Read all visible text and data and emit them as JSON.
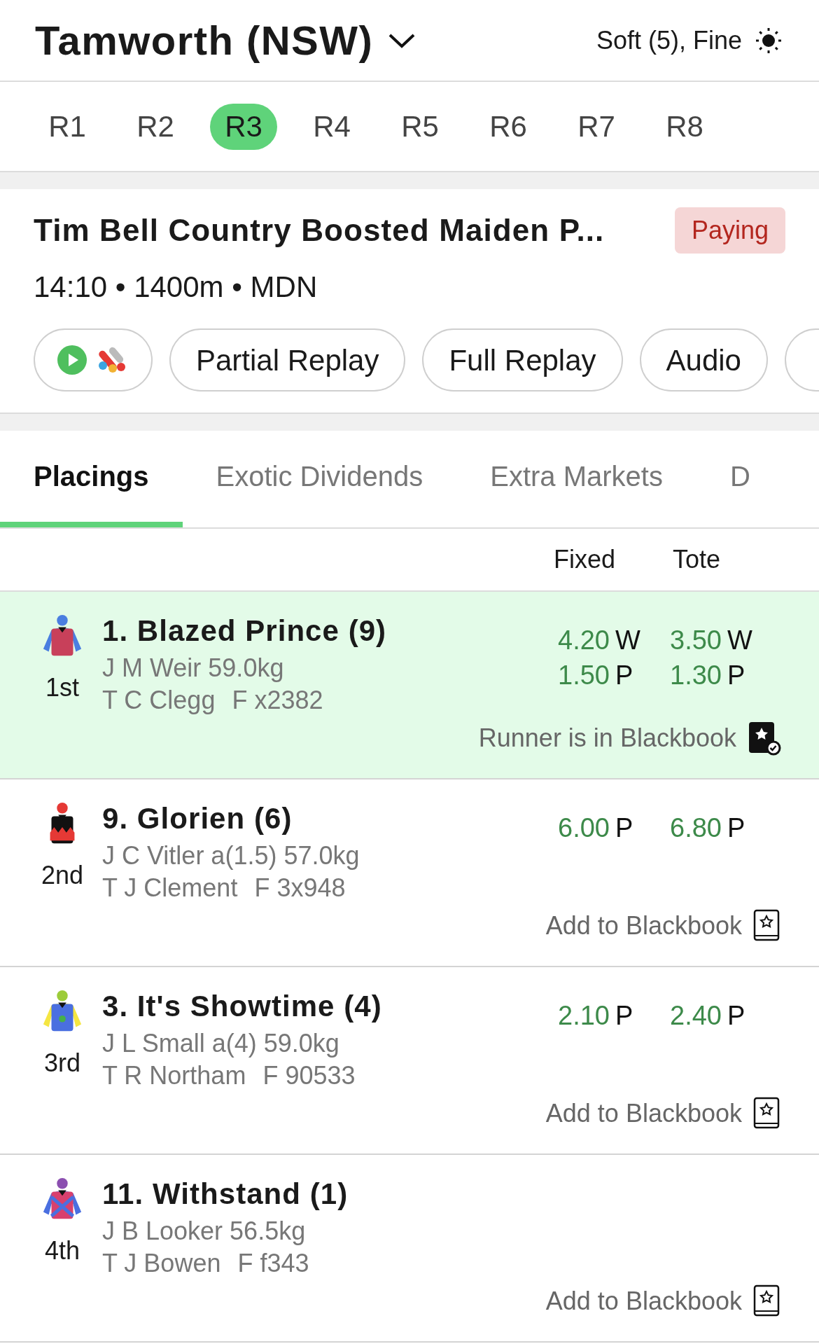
{
  "header": {
    "venue": "Tamworth (NSW)",
    "conditions": "Soft (5), Fine"
  },
  "race_tabs": [
    {
      "label": "R1",
      "selected": false
    },
    {
      "label": "R2",
      "selected": false
    },
    {
      "label": "R3",
      "selected": true
    },
    {
      "label": "R4",
      "selected": false
    },
    {
      "label": "R5",
      "selected": false
    },
    {
      "label": "R6",
      "selected": false
    },
    {
      "label": "R7",
      "selected": false
    },
    {
      "label": "R8",
      "selected": false
    }
  ],
  "race": {
    "title": "Tim Bell Country Boosted Maiden P...",
    "status": "Paying",
    "details": "14:10 • 1400m • MDN"
  },
  "media_buttons": [
    {
      "kind": "stream"
    },
    {
      "kind": "text",
      "label": "Partial Replay"
    },
    {
      "kind": "text",
      "label": "Full Replay"
    },
    {
      "kind": "text",
      "label": "Audio"
    },
    {
      "kind": "edge"
    }
  ],
  "view_tabs": [
    {
      "label": "Placings",
      "selected": true
    },
    {
      "label": "Exotic Dividends",
      "selected": false
    },
    {
      "label": "Extra Markets",
      "selected": false
    },
    {
      "label": "D",
      "selected": false
    }
  ],
  "columns": [
    "Fixed",
    "Tote"
  ],
  "runners": [
    {
      "position": "1st",
      "name": "1. Blazed Prince (9)",
      "jockey": "J M Weir 59.0kg",
      "trainer": "T C Clegg",
      "form": "F x2382",
      "silks": {
        "kind": "plain",
        "color": "#c8405a"
      },
      "highlighted": true,
      "fixed": [
        {
          "price": "4.20",
          "type": "W"
        },
        {
          "price": "1.50",
          "type": "P"
        }
      ],
      "tote": [
        {
          "price": "3.50",
          "type": "W"
        },
        {
          "price": "1.30",
          "type": "P"
        }
      ],
      "blackbook": "Runner is in Blackbook",
      "in_blackbook": true
    },
    {
      "position": "2nd",
      "name": "9. Glorien (6)",
      "jockey": "J C Vitler a(1.5) 57.0kg",
      "trainer": "T J Clement",
      "form": "F 3x948",
      "silks": {
        "kind": "zigzag",
        "color": "#111111"
      },
      "highlighted": false,
      "fixed": [
        {
          "price": "6.00",
          "type": "P"
        }
      ],
      "tote": [
        {
          "price": "6.80",
          "type": "P"
        }
      ],
      "blackbook": "Add to Blackbook",
      "in_blackbook": false
    },
    {
      "position": "3rd",
      "name": "3. It's Showtime (4)",
      "jockey": "J L Small a(4) 59.0kg",
      "trainer": "T R Northam",
      "form": "F 90533",
      "silks": {
        "kind": "spot",
        "color": "#4a6fe0"
      },
      "highlighted": false,
      "fixed": [
        {
          "price": "2.10",
          "type": "P"
        }
      ],
      "tote": [
        {
          "price": "2.40",
          "type": "P"
        }
      ],
      "blackbook": "Add to Blackbook",
      "in_blackbook": false
    },
    {
      "position": "4th",
      "name": "11. Withstand (1)",
      "jockey": "J B Looker 56.5kg",
      "trainer": "T J Bowen",
      "form": "F f343",
      "silks": {
        "kind": "cross",
        "color": "#d8406e"
      },
      "highlighted": false,
      "blackbook": "Add to Blackbook",
      "in_blackbook": false
    }
  ]
}
